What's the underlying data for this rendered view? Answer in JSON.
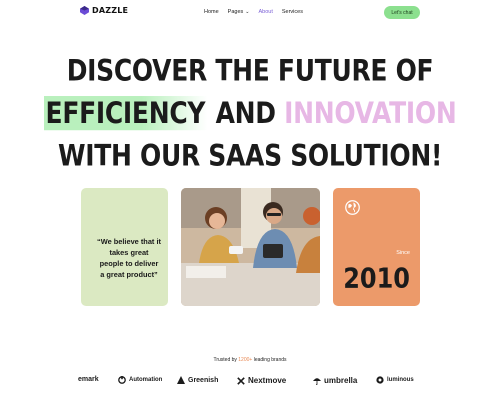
{
  "nav": {
    "logo_text": "DAZZLE",
    "links": [
      {
        "label": "Home"
      },
      {
        "label": "Pages"
      },
      {
        "label": "About"
      },
      {
        "label": "Services"
      }
    ],
    "active_link": "About",
    "cta_label": "Let's chat"
  },
  "hero": {
    "line1": "DISCOVER THE FUTURE OF",
    "line2_highlight": "EFFICIENCY",
    "line2_mid": "AND",
    "line2_accent": "INNOVATION",
    "line3": "WITH OUR SAAS SOLUTION!"
  },
  "cards": {
    "quote": "“We believe that it takes great people to deliver a great product”",
    "since_label": "Since",
    "since_year": "2010",
    "photo_icon": "team-photo"
  },
  "trusted": {
    "prefix": "Trusted by",
    "count": "1200+",
    "suffix": "leading brands"
  },
  "brands": [
    "emark",
    "Automation",
    "Greenish",
    "Nextmove",
    "umbrella",
    "luminous"
  ],
  "colors": {
    "cta": "#8ce08f",
    "highlight_green": "#b9f0bd",
    "accent_pink": "#e7b7e5",
    "card_green": "#dbe9c2",
    "card_orange": "#ec9a6a",
    "active_link": "#7a5fd6",
    "trusted_accent": "#e98a56"
  }
}
